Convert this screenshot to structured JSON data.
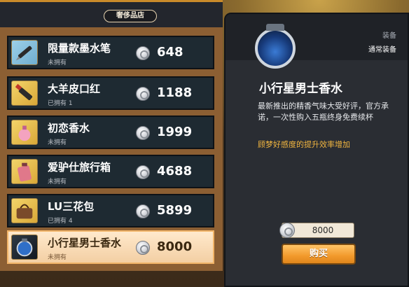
{
  "shop": {
    "title": "奢侈品店",
    "items": [
      {
        "name": "限量款墨水笔",
        "owned": "未拥有",
        "price": "648",
        "icon": "pen-icon"
      },
      {
        "name": "大羊皮口红",
        "owned": "已拥有 1",
        "price": "1188",
        "icon": "lipstick-icon"
      },
      {
        "name": "初恋香水",
        "owned": "未拥有",
        "price": "1999",
        "icon": "perfume-icon"
      },
      {
        "name": "爱驴仕旅行箱",
        "owned": "未拥有",
        "price": "4688",
        "icon": "suitcase-icon"
      },
      {
        "name": "LU三花包",
        "owned": "已拥有 4",
        "price": "5899",
        "icon": "handbag-icon"
      },
      {
        "name": "小行星男士香水",
        "owned": "未拥有",
        "price": "8000",
        "icon": "mens-perfume-icon",
        "selected": true
      }
    ]
  },
  "detail": {
    "category": "装备",
    "slot": "通常装备",
    "title": "小行星男士香水",
    "description": "最新推出的精香气味大受好评，官方承诺，一次性购入五瓶终身免费续杯",
    "effect": "顾梦好感度的提升效率增加",
    "price": "8000",
    "buy_label": "购买",
    "icon": "mens-perfume-icon"
  },
  "colors": {
    "accent": "#f29a2c",
    "effect_text": "#f2b640",
    "selected_row": "#f3cfa3"
  }
}
